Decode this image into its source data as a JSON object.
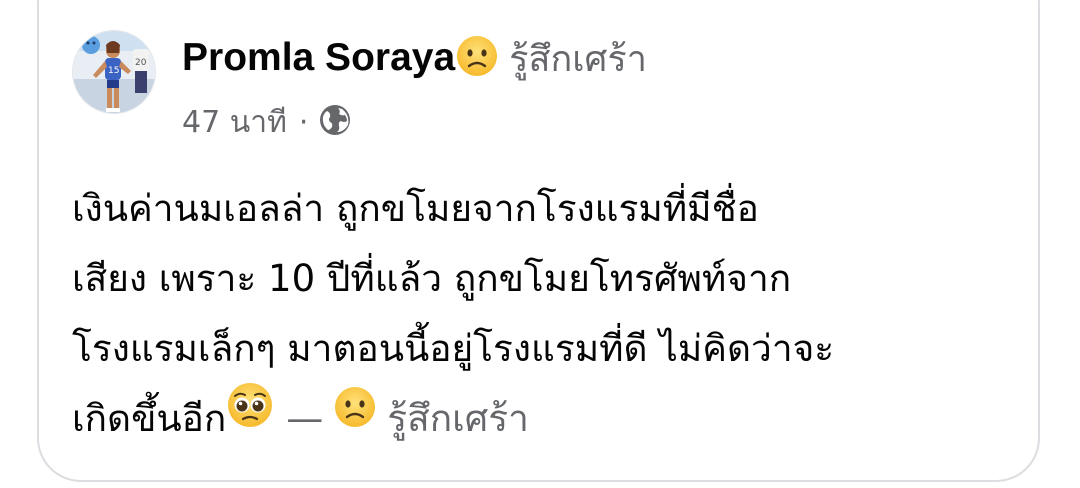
{
  "post": {
    "author_name": "Promla Soraya",
    "feeling_icon": "sad-face-emoji",
    "feeling_label": "รู้สึกเศร้า",
    "timestamp": "47 นาที",
    "separator": "·",
    "audience_icon": "globe-icon",
    "body_lines": [
      "เงินค่านมเอลล่า ถูกขโมยจากโรงแรมที่มีชื่อ",
      "เสียง เพราะ 10 ปีที่แล้ว ถูกขโมยโทรศัพท์จาก",
      "โรงแรมเล็กๆ มาตอนนี้อยู่โรงแรมที่ดี ไม่คิดว่าจะ",
      "เกิดขึ้นอีก"
    ],
    "body_end_icon": "pleading-face-emoji",
    "body_dash": "—",
    "body_feeling_icon": "sad-face-emoji",
    "body_feeling_label": "รู้สึกเศร้า"
  },
  "colors": {
    "text_primary": "#050505",
    "text_secondary": "#65676b",
    "card_border": "#dcdde1",
    "emoji_yellow": "#fbc02d"
  }
}
